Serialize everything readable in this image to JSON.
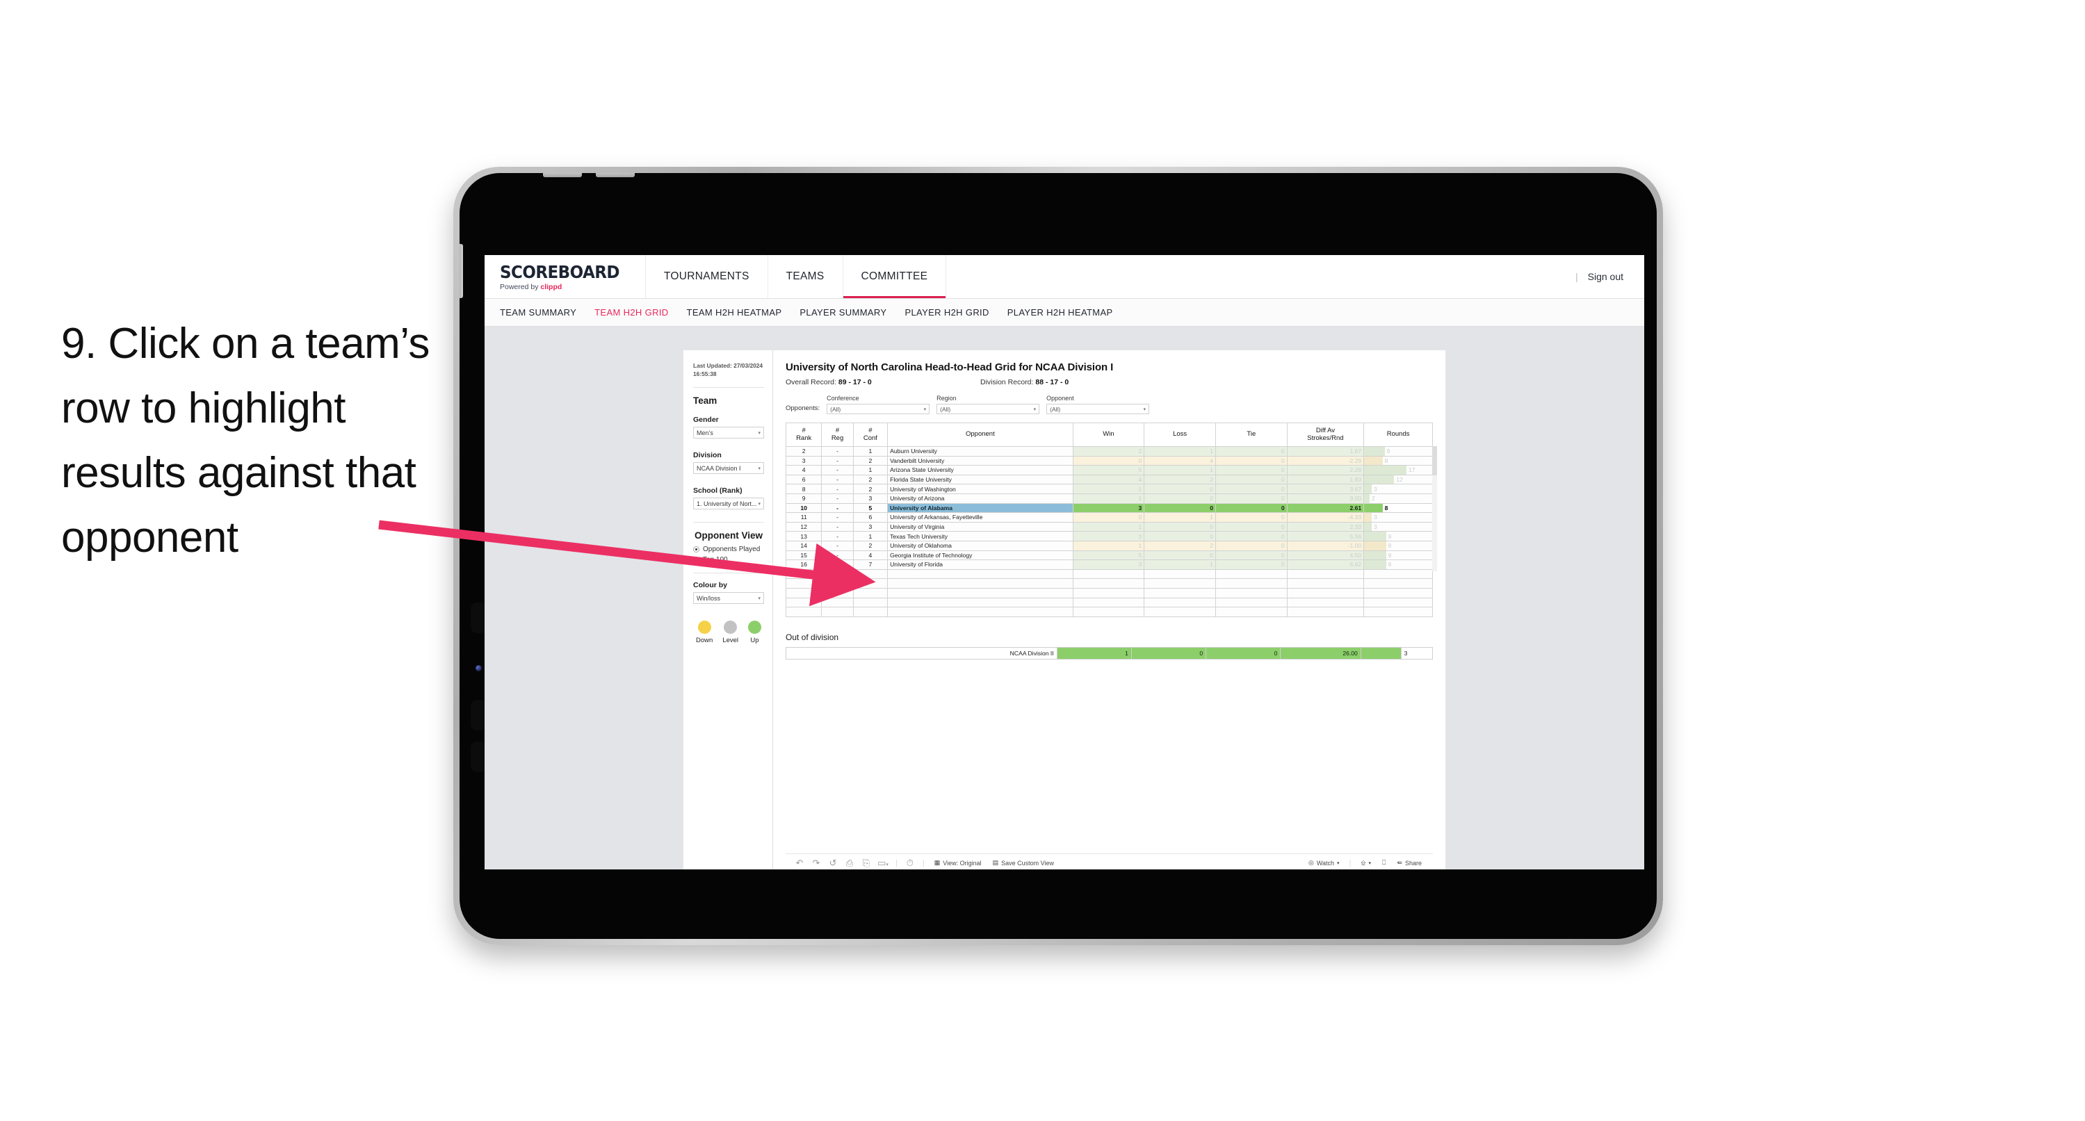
{
  "instruction": {
    "text": "9. Click on a team’s row to highlight results against that opponent"
  },
  "app": {
    "logo_main": "SCOREBOARD",
    "logo_sub_prefix": "Powered by ",
    "logo_brand": "clippd",
    "top_nav": [
      {
        "label": "TOURNAMENTS",
        "active": false
      },
      {
        "label": "TEAMS",
        "active": false
      },
      {
        "label": "COMMITTEE",
        "active": true
      }
    ],
    "sign_out": "Sign out",
    "divider": "|",
    "sub_nav": [
      {
        "label": "TEAM SUMMARY",
        "active": false
      },
      {
        "label": "TEAM H2H GRID",
        "active": true
      },
      {
        "label": "TEAM H2H HEATMAP",
        "active": false
      },
      {
        "label": "PLAYER SUMMARY",
        "active": false
      },
      {
        "label": "PLAYER H2H GRID",
        "active": false
      },
      {
        "label": "PLAYER H2H HEATMAP",
        "active": false
      }
    ]
  },
  "panel": {
    "last_updated": "Last Updated: 27/03/2024 16:55:38",
    "team_heading": "Team",
    "gender_label": "Gender",
    "gender_value": "Men’s",
    "division_label": "Division",
    "division_value": "NCAA Division I",
    "school_label": "School (Rank)",
    "school_value": "1. University of Nort...",
    "opponent_view_heading": "Opponent View",
    "radio_options": [
      {
        "label": "Opponents Played",
        "selected": true
      },
      {
        "label": "Top 100",
        "selected": false
      }
    ],
    "colour_by_label": "Colour by",
    "colour_by_value": "Win/loss",
    "legend": [
      {
        "label": "Down",
        "color": "#f5d147"
      },
      {
        "label": "Level",
        "color": "#c2c2c2"
      },
      {
        "label": "Up",
        "color": "#8ccf6a"
      }
    ],
    "caret": "▾"
  },
  "viz": {
    "title": "University of North Carolina Head-to-Head Grid for NCAA Division I",
    "overall_record_label": "Overall Record: ",
    "overall_record_value": "89 - 17 - 0",
    "division_record_label": "Division Record: ",
    "division_record_value": "88 - 17 - 0",
    "opponents_label": "Opponents:",
    "filters": [
      {
        "label": "Conference",
        "value": "(All)"
      },
      {
        "label": "Region",
        "value": "(All)"
      },
      {
        "label": "Opponent",
        "value": "(All)"
      }
    ],
    "caret": "▾"
  },
  "chart_data": {
    "type": "table",
    "title": "University of North Carolina Head-to-Head Grid for NCAA Division I",
    "columns": [
      "# Rank",
      "# Reg",
      "# Conf",
      "Opponent",
      "Win",
      "Loss",
      "Tie",
      "Diff Av Strokes/Rnd",
      "Rounds"
    ],
    "column_header_lines": [
      [
        "#",
        "Rank"
      ],
      [
        "#",
        "Reg"
      ],
      [
        "#",
        "Conf"
      ],
      [
        "Opponent"
      ],
      [
        "Win"
      ],
      [
        "Loss"
      ],
      [
        "Tie"
      ],
      [
        "Diff Av",
        "Strokes/Rnd"
      ],
      [
        "Rounds"
      ]
    ],
    "rows": [
      {
        "rank": "2",
        "reg": "-",
        "conf": "1",
        "opponent": "Auburn University",
        "win": "2",
        "loss": "1",
        "tie": "0",
        "diff": "1.67",
        "rounds": "9",
        "tone": "up",
        "selected": false,
        "bar": 0.3
      },
      {
        "rank": "3",
        "reg": "-",
        "conf": "2",
        "opponent": "Vanderbilt University",
        "win": "0",
        "loss": "4",
        "tie": "0",
        "diff": "-2.29",
        "rounds": "8",
        "tone": "down",
        "selected": false,
        "bar": 0.27
      },
      {
        "rank": "4",
        "reg": "-",
        "conf": "1",
        "opponent": "Arizona State University",
        "win": "5",
        "loss": "1",
        "tie": "0",
        "diff": "2.28",
        "rounds": "17",
        "tone": "up",
        "selected": false,
        "bar": 0.62
      },
      {
        "rank": "6",
        "reg": "-",
        "conf": "2",
        "opponent": "Florida State University",
        "win": "4",
        "loss": "2",
        "tie": "0",
        "diff": "1.83",
        "rounds": "12",
        "tone": "up",
        "selected": false,
        "bar": 0.44
      },
      {
        "rank": "8",
        "reg": "-",
        "conf": "2",
        "opponent": "University of Washington",
        "win": "1",
        "loss": "0",
        "tie": "0",
        "diff": "3.67",
        "rounds": "3",
        "tone": "up",
        "selected": false,
        "bar": 0.11
      },
      {
        "rank": "9",
        "reg": "-",
        "conf": "3",
        "opponent": "University of Arizona",
        "win": "1",
        "loss": "0",
        "tie": "0",
        "diff": "9.00",
        "rounds": "2",
        "tone": "up",
        "selected": false,
        "bar": 0.08
      },
      {
        "rank": "10",
        "reg": "-",
        "conf": "5",
        "opponent": "University of Alabama",
        "win": "3",
        "loss": "0",
        "tie": "0",
        "diff": "2.61",
        "rounds": "8",
        "tone": "up",
        "selected": true,
        "bar": 0.27
      },
      {
        "rank": "11",
        "reg": "-",
        "conf": "6",
        "opponent": "University of Arkansas, Fayetteville",
        "win": "0",
        "loss": "1",
        "tie": "0",
        "diff": "-4.33",
        "rounds": "3",
        "tone": "down",
        "selected": false,
        "bar": 0.11
      },
      {
        "rank": "12",
        "reg": "-",
        "conf": "3",
        "opponent": "University of Virginia",
        "win": "1",
        "loss": "0",
        "tie": "0",
        "diff": "2.33",
        "rounds": "3",
        "tone": "up",
        "selected": false,
        "bar": 0.11
      },
      {
        "rank": "13",
        "reg": "-",
        "conf": "1",
        "opponent": "Texas Tech University",
        "win": "3",
        "loss": "0",
        "tie": "0",
        "diff": "5.56",
        "rounds": "9",
        "tone": "up",
        "selected": false,
        "bar": 0.32
      },
      {
        "rank": "14",
        "reg": "-",
        "conf": "2",
        "opponent": "University of Oklahoma",
        "win": "1",
        "loss": "2",
        "tie": "0",
        "diff": "-1.00",
        "rounds": "9",
        "tone": "down",
        "selected": false,
        "bar": 0.32
      },
      {
        "rank": "15",
        "reg": "-",
        "conf": "4",
        "opponent": "Georgia Institute of Technology",
        "win": "5",
        "loss": "0",
        "tie": "0",
        "diff": "4.50",
        "rounds": "9",
        "tone": "up",
        "selected": false,
        "bar": 0.32
      },
      {
        "rank": "16",
        "reg": "-",
        "conf": "7",
        "opponent": "University of Florida",
        "win": "3",
        "loss": "1",
        "tie": "0",
        "diff": "6.62",
        "rounds": "9",
        "tone": "up",
        "selected": false,
        "bar": 0.32
      }
    ],
    "colors": {
      "up": "#8ccf6a",
      "down": "#f5d147",
      "level": "#c2c2c2",
      "selected_name": "#8bbdd9"
    }
  },
  "out_of_division": {
    "heading": "Out of division",
    "row": {
      "name": "NCAA Division II",
      "win": "1",
      "loss": "0",
      "tie": "0",
      "diff": "26.00",
      "rounds": "3"
    }
  },
  "toolbar": {
    "view_label": "View: Original",
    "save_label": "Save Custom View",
    "watch_label": "Watch",
    "share_label": "Share",
    "caret": "▾",
    "sep": "|"
  }
}
